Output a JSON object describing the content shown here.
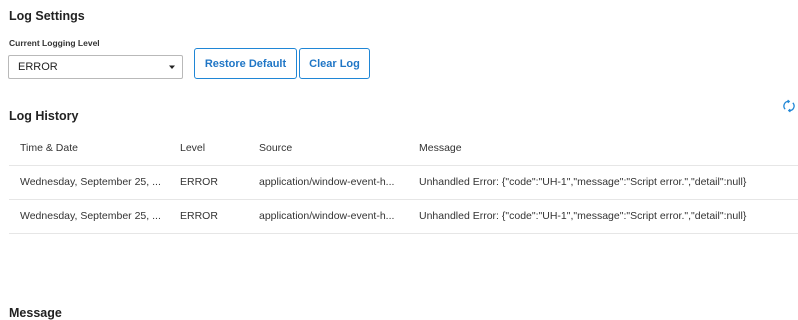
{
  "settings": {
    "title": "Log Settings",
    "level_label": "Current Logging Level",
    "level_value": "ERROR",
    "restore_label": "Restore Default",
    "clear_label": "Clear Log"
  },
  "history": {
    "title": "Log History",
    "columns": [
      "Time & Date",
      "Level",
      "Source",
      "Message"
    ],
    "rows": [
      {
        "time": "Wednesday, September 25, ...",
        "level": "ERROR",
        "source": "application/window-event-h...",
        "message": "Unhandled Error: {\"code\":\"UH-1\",\"message\":\"Script error.\",\"detail\":null}"
      },
      {
        "time": "Wednesday, September 25, ...",
        "level": "ERROR",
        "source": "application/window-event-h...",
        "message": "Unhandled Error: {\"code\":\"UH-1\",\"message\":\"Script error.\",\"detail\":null}"
      }
    ]
  },
  "message_section": {
    "title": "Message"
  },
  "icons": {
    "refresh": "refresh-icon",
    "dropdown": "chevron-down-icon"
  },
  "colors": {
    "accent": "#1f86d6"
  }
}
